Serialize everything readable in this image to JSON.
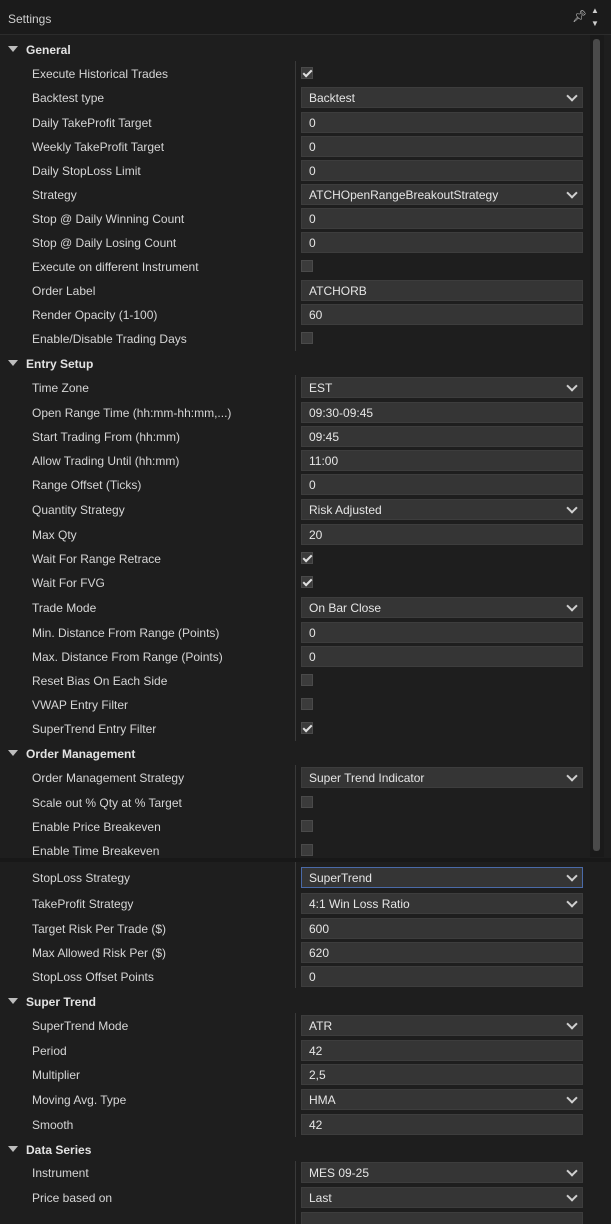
{
  "window": {
    "title": "Settings"
  },
  "categories": {
    "general": "General",
    "entry_setup": "Entry Setup",
    "order_management": "Order Management",
    "super_trend": "Super Trend",
    "data_series": "Data Series"
  },
  "props": {
    "execute_historical_trades": {
      "label": "Execute Historical Trades",
      "checked": true
    },
    "backtest_type": {
      "label": "Backtest type",
      "value": "Backtest"
    },
    "daily_takeprofit_target": {
      "label": "Daily TakeProfit Target",
      "value": "0"
    },
    "weekly_takeprofit_target": {
      "label": "Weekly TakeProfit Target",
      "value": "0"
    },
    "daily_stoploss_limit": {
      "label": "Daily StopLoss Limit",
      "value": "0"
    },
    "strategy": {
      "label": "Strategy",
      "value": "ATCHOpenRangeBreakoutStrategy"
    },
    "stop_daily_winning_count": {
      "label": "Stop @ Daily Winning Count",
      "value": "0"
    },
    "stop_daily_losing_count": {
      "label": "Stop @ Daily Losing Count",
      "value": "0"
    },
    "execute_on_different_instrument": {
      "label": "Execute on different Instrument",
      "checked": false
    },
    "order_label": {
      "label": "Order Label",
      "value": "ATCHORB"
    },
    "render_opacity": {
      "label": "Render Opacity (1-100)",
      "value": "60"
    },
    "enable_disable_trading_days": {
      "label": "Enable/Disable Trading Days",
      "checked": false
    },
    "time_zone": {
      "label": "Time Zone",
      "value": "EST"
    },
    "open_range_time": {
      "label": "Open Range Time (hh:mm-hh:mm,...)",
      "value": "09:30-09:45"
    },
    "start_trading_from": {
      "label": "Start Trading From (hh:mm)",
      "value": "09:45"
    },
    "allow_trading_until": {
      "label": "Allow Trading Until (hh:mm)",
      "value": "11:00"
    },
    "range_offset": {
      "label": "Range Offset (Ticks)",
      "value": "0"
    },
    "quantity_strategy": {
      "label": "Quantity Strategy",
      "value": "Risk Adjusted"
    },
    "max_qty": {
      "label": "Max Qty",
      "value": "20"
    },
    "wait_for_range_retrace": {
      "label": "Wait For Range Retrace",
      "checked": true
    },
    "wait_for_fvg": {
      "label": "Wait For FVG",
      "checked": true
    },
    "trade_mode": {
      "label": "Trade Mode",
      "value": "On Bar Close"
    },
    "min_distance_from_range": {
      "label": "Min. Distance From Range (Points)",
      "value": "0"
    },
    "max_distance_from_range": {
      "label": "Max. Distance From Range (Points)",
      "value": "0"
    },
    "reset_bias_on_each_side": {
      "label": "Reset Bias On Each Side",
      "checked": false
    },
    "vwap_entry_filter": {
      "label": "VWAP Entry Filter",
      "checked": false
    },
    "supertrend_entry_filter": {
      "label": "SuperTrend Entry Filter",
      "checked": true
    },
    "order_management_strategy": {
      "label": "Order Management Strategy",
      "value": "Super Trend Indicator"
    },
    "scale_out_qty": {
      "label": "Scale out % Qty at % Target",
      "checked": false
    },
    "enable_price_breakeven": {
      "label": "Enable Price Breakeven",
      "checked": false
    },
    "enable_time_breakeven": {
      "label": "Enable Time Breakeven",
      "checked": false
    },
    "stoploss_strategy": {
      "label": "StopLoss Strategy",
      "value": "SuperTrend"
    },
    "takeprofit_strategy": {
      "label": "TakeProfit Strategy",
      "value": "4:1 Win Loss Ratio"
    },
    "target_risk_per_trade": {
      "label": "Target Risk Per Trade ($)",
      "value": "600"
    },
    "max_allowed_risk_per": {
      "label": "Max Allowed Risk Per ($)",
      "value": "620"
    },
    "stoploss_offset_points": {
      "label": "StopLoss Offset Points",
      "value": "0"
    },
    "supertrend_mode": {
      "label": "SuperTrend Mode",
      "value": "ATR"
    },
    "period": {
      "label": "Period",
      "value": "42"
    },
    "multiplier": {
      "label": "Multiplier",
      "value": "2,5"
    },
    "moving_avg_type": {
      "label": "Moving Avg. Type",
      "value": "HMA"
    },
    "smooth": {
      "label": "Smooth",
      "value": "42"
    },
    "instrument": {
      "label": "Instrument",
      "value": "MES 09-25"
    },
    "price_based_on": {
      "label": "Price based on",
      "value": "Last"
    }
  }
}
